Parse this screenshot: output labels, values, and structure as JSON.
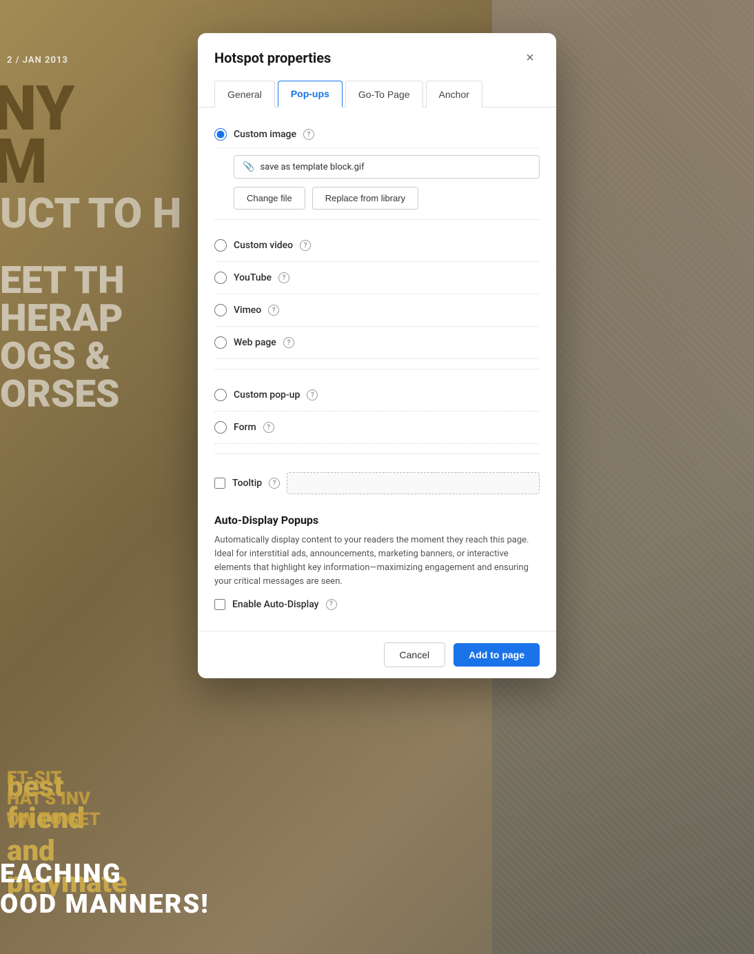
{
  "dialog": {
    "title": "Hotspot properties",
    "close_label": "×",
    "tabs": [
      {
        "id": "general",
        "label": "General",
        "active": false
      },
      {
        "id": "popups",
        "label": "Pop-ups",
        "active": true
      },
      {
        "id": "goto",
        "label": "Go-To Page",
        "active": false
      },
      {
        "id": "anchor",
        "label": "Anchor",
        "active": false
      }
    ],
    "custom_image": {
      "label": "Custom image",
      "file_name": "save as template block.gif",
      "change_file_label": "Change file",
      "replace_library_label": "Replace from library"
    },
    "radio_options": [
      {
        "id": "custom_video",
        "label": "Custom video",
        "has_help": true
      },
      {
        "id": "youtube",
        "label": "YouTube",
        "has_help": true
      },
      {
        "id": "vimeo",
        "label": "Vimeo",
        "has_help": true
      },
      {
        "id": "web_page",
        "label": "Web page",
        "has_help": true
      },
      {
        "id": "custom_popup",
        "label": "Custom pop-up",
        "has_help": true
      },
      {
        "id": "form",
        "label": "Form",
        "has_help": true
      }
    ],
    "tooltip": {
      "label": "Tooltip",
      "has_help": true,
      "value": ""
    },
    "auto_display": {
      "title": "Auto-Display Popups",
      "description": "Automatically display content to your readers the moment they reach this page. Ideal for interstitial ads, announcements, marketing banners, or interactive elements that highlight key information—maximizing engagement and ensuring your critical messages are seen.",
      "enable_label": "Enable Auto-Display",
      "has_help": true
    },
    "footer": {
      "cancel_label": "Cancel",
      "add_label": "Add to page"
    }
  }
}
